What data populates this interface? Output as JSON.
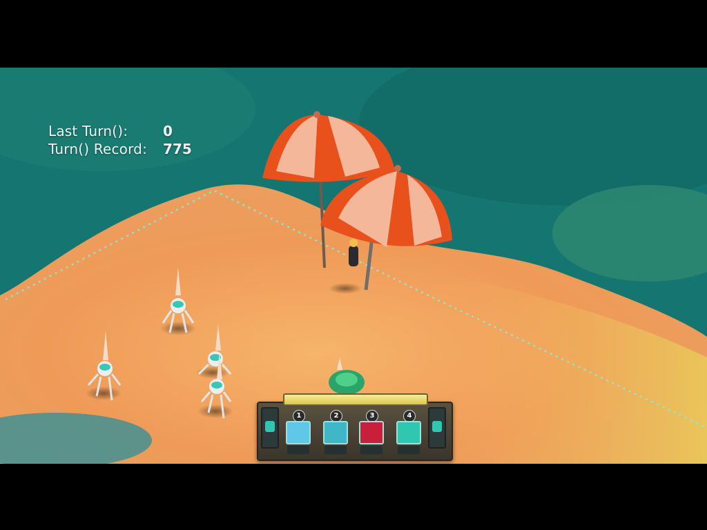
{
  "hud": {
    "last_turn_label": "Last Turn():",
    "last_turn_value": "0",
    "record_label": "Turn() Record:",
    "record_value": "775"
  },
  "card_bar": {
    "cards": [
      {
        "slot": "1",
        "icon": "ice-shard-icon",
        "color": "#5fc7e8"
      },
      {
        "slot": "2",
        "icon": "cannon-icon",
        "color": "#3fb7c7"
      },
      {
        "slot": "3",
        "icon": "red-orb-icon",
        "color": "#c8203a"
      },
      {
        "slot": "4",
        "icon": "skull-drone-icon",
        "color": "#2fc7b0"
      }
    ]
  },
  "colors": {
    "sand": "#f2a45c",
    "water": "#147a74",
    "umbrella_red": "#e8501c",
    "umbrella_white": "#f6c2a8",
    "hud_text": "#eef6f4"
  }
}
